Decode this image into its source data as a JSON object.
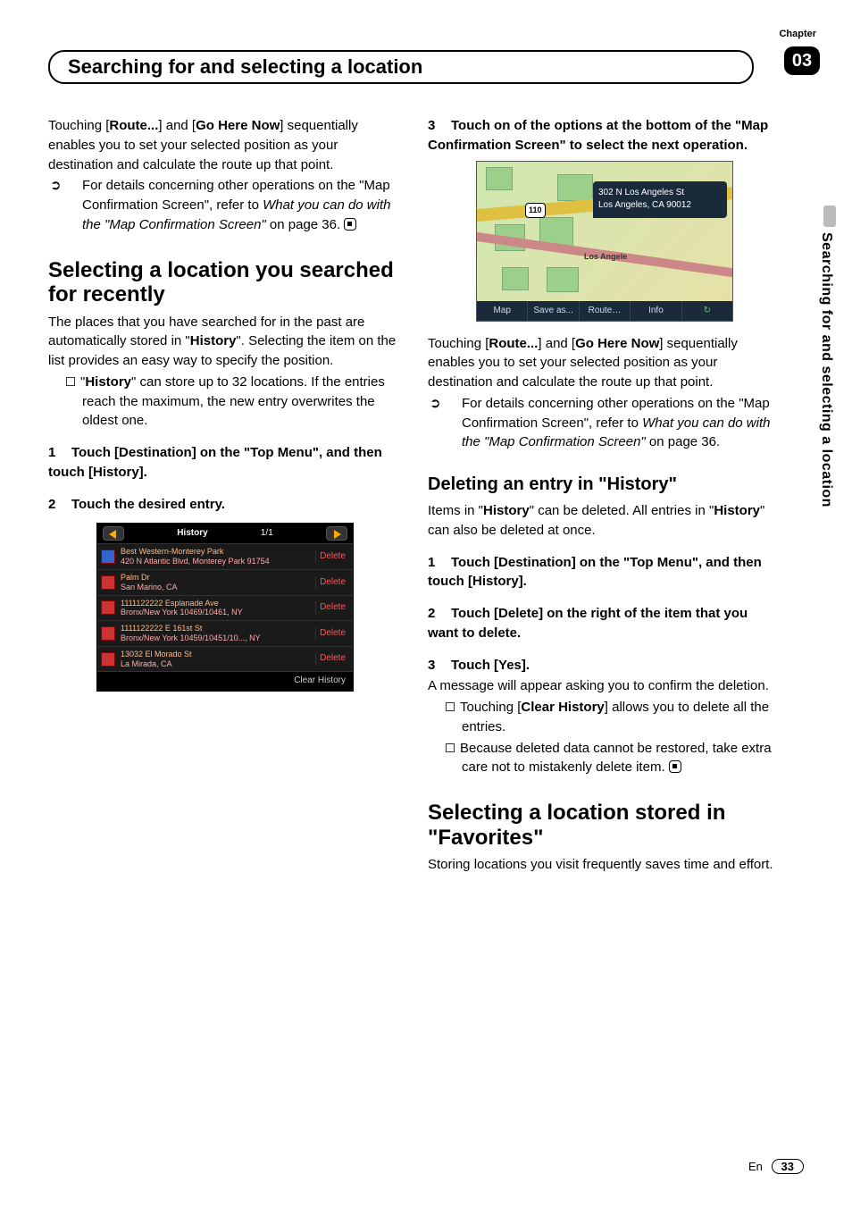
{
  "chapter": {
    "label": "Chapter",
    "number": "03"
  },
  "header": {
    "title": "Searching for and selecting a location"
  },
  "side_tab": "Searching for and selecting a location",
  "left": {
    "intro1": "Touching [",
    "intro_route": "Route...",
    "intro2": "] and [",
    "intro_go": "Go Here Now",
    "intro3": "] sequentially enables you to set your selected position as your destination and calculate the route up that point.",
    "bullet_lead": "For details concerning other operations on the \"Map Confirmation Screen\", refer to ",
    "bullet_ital": "What you can do with the \"Map Confirmation Screen\"",
    "bullet_tail": " on page 36.",
    "h2": "Selecting a location you searched for recently",
    "p1a": "The places that you have searched for in the past are automatically stored in \"",
    "p1b": "History",
    "p1c": "\". Selecting the item on the list provides an easy way to specify the position.",
    "note1a": "\"",
    "note1b": "History",
    "note1c": "\" can store up to 32 locations. If the entries reach the maximum, the new entry overwrites the oldest one.",
    "step1": "Touch [Destination] on the \"Top Menu\", and then touch [History].",
    "step2": "Touch the desired entry.",
    "ss1": {
      "title": "History",
      "page": "1/1",
      "rows": [
        {
          "l1": "Best Western-Monterey Park",
          "l2": "420 N Atlantic Blvd, Monterey Park 91754",
          "del": "Delete",
          "hotel": true
        },
        {
          "l1": "Palm Dr",
          "l2": "San Marino, CA",
          "del": "Delete"
        },
        {
          "l1": "1111122222 Esplanade Ave",
          "l2": "Bronx/New York 10469/10461, NY",
          "del": "Delete"
        },
        {
          "l1": "1111122222 E 161st St",
          "l2": "Bronx/New York 10459/10451/10..., NY",
          "del": "Delete"
        },
        {
          "l1": "13032 El Morado St",
          "l2": "La Mirada, CA",
          "del": "Delete"
        }
      ],
      "clear": "Clear History"
    }
  },
  "right": {
    "step3": "Touch on of the options at the bottom of the \"Map Confirmation Screen\" to select the next operation.",
    "ss2": {
      "addr1": "302 N Los Angeles St",
      "addr2": "Los Angeles, CA 90012",
      "shield": "110",
      "city": "Los Angele",
      "btns": [
        "Map",
        "Save as...",
        "Route…",
        "Info",
        "↻"
      ]
    },
    "intro1": "Touching [",
    "intro_route": "Route...",
    "intro2": "] and [",
    "intro_go": "Go Here Now",
    "intro3": "] sequentially enables you to set your selected position as your destination and calculate the route up that point.",
    "bullet_lead": "For details concerning other operations on the \"Map Confirmation Screen\", refer to ",
    "bullet_ital": "What you can do with the \"Map Confirmation Screen\"",
    "bullet_tail": " on page 36.",
    "h3a": "Deleting an entry in \"",
    "h3b": "History",
    "h3c": "\"",
    "p1a": "Items in \"",
    "p1b": "History",
    "p1c": "\" can be deleted. All entries in \"",
    "p1d": "History",
    "p1e": "\" can also be deleted at once.",
    "dstep1": "Touch [Destination] on the \"Top Menu\", and then touch [History].",
    "dstep2": "Touch [Delete] on the right of the item that you want to delete.",
    "dstep3": "Touch [Yes].",
    "dp": "A message will appear asking you to confirm the deletion.",
    "dnote1a": "Touching [",
    "dnote1b": "Clear History",
    "dnote1c": "] allows you to delete all the entries.",
    "dnote2": "Because deleted data cannot be restored, take extra care not to mistakenly delete item.",
    "h2a": "Selecting a location stored in \"",
    "h2b": "Favorites",
    "h2c": "\"",
    "p2": "Storing locations you visit frequently saves time and effort."
  },
  "footer": {
    "lang": "En",
    "page": "33"
  }
}
